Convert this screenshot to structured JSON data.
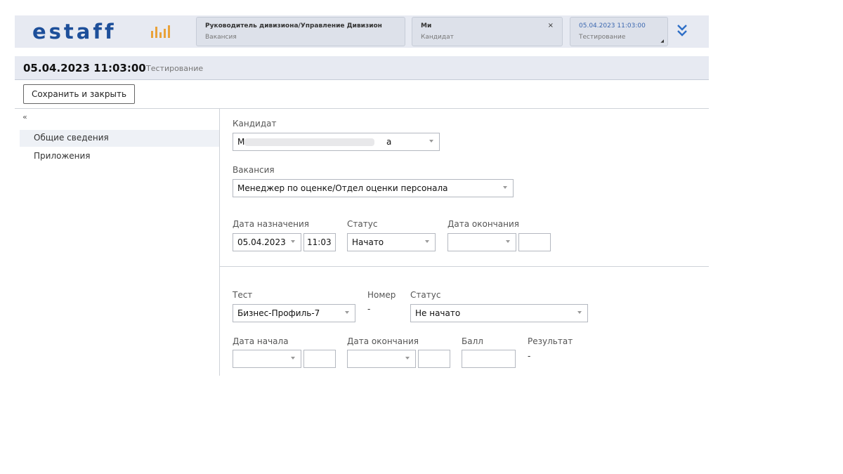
{
  "header": {
    "logo_text": "estaff",
    "brand_color": "#1d4f9a",
    "accent_color": "#e9a23a",
    "cards": [
      {
        "line1": "Руководитель дивизиона/Управление Дивизион",
        "line2": "Вакансия"
      },
      {
        "line1": "Ми",
        "line2": "Кандидат",
        "close": "×"
      },
      {
        "line1": "05.04.2023 11:03:00",
        "line2": "Тестирование"
      }
    ],
    "expand_icon": "double-chevron-down-icon"
  },
  "titlebar": {
    "main": "05.04.2023 11:03:00",
    "sub": "Тестирование"
  },
  "toolbar": {
    "save_close_label": "Сохранить и закрыть"
  },
  "sidebar": {
    "collapse_label": "«",
    "items": [
      {
        "label": "Общие сведения",
        "active": true
      },
      {
        "label": "Приложения",
        "active": false
      }
    ]
  },
  "form": {
    "candidate": {
      "label": "Кандидат",
      "value_start": "М",
      "value_end": "а"
    },
    "vacancy": {
      "label": "Вакансия",
      "value": "Менеджер по оценке/Отдел оценки персонала"
    },
    "assign_date": {
      "label": "Дата назначения",
      "date": "05.04.2023",
      "time": "11:03"
    },
    "status": {
      "label": "Статус",
      "value": "Начато"
    },
    "end_date": {
      "label": "Дата окончания",
      "date": "",
      "time": ""
    }
  },
  "test": {
    "test_field": {
      "label": "Тест",
      "value": "Бизнес-Профиль-7"
    },
    "number": {
      "label": "Номер",
      "value": "-"
    },
    "status": {
      "label": "Статус",
      "value": "Не начато"
    },
    "start_date": {
      "label": "Дата начала",
      "date": "",
      "time": ""
    },
    "end_date": {
      "label": "Дата окончания",
      "date": "",
      "time": ""
    },
    "score": {
      "label": "Балл",
      "value": ""
    },
    "result": {
      "label": "Результат",
      "value": "-"
    }
  }
}
